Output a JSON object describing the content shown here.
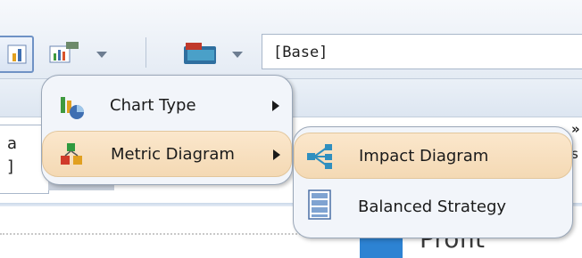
{
  "toolbar": {
    "combo_value": "[Base]"
  },
  "panel": {
    "cell_line1": "a",
    "cell_line2": "]",
    "right_fragment_top": "»",
    "right_fragment_mid": "s"
  },
  "bottom": {
    "text": "Profit"
  },
  "menu1": {
    "items": [
      {
        "label": "Chart Type",
        "icon": "chart-type-icon"
      },
      {
        "label": "Metric Diagram",
        "icon": "metric-diagram-icon"
      }
    ]
  },
  "menu2": {
    "items": [
      {
        "label": "Impact Diagram",
        "icon": "impact-diagram-icon"
      },
      {
        "label": "Balanced Strategy",
        "icon": "balanced-strategy-icon"
      }
    ]
  },
  "colors": {
    "highlight": "#f4d9b4",
    "accent_blue": "#2d83d3"
  }
}
